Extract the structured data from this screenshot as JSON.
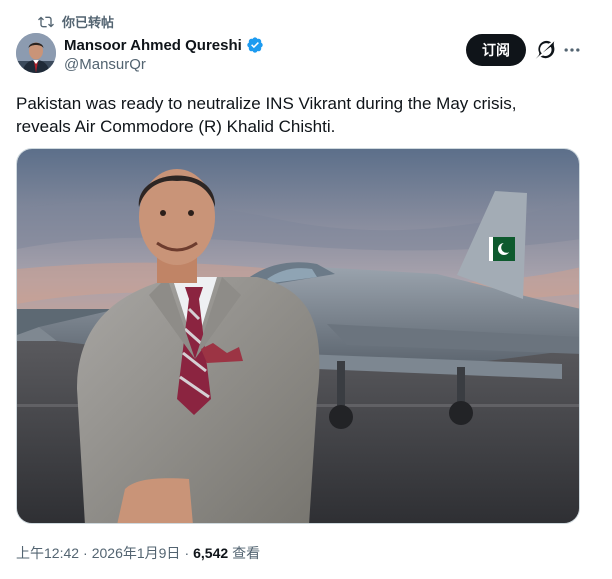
{
  "repost": {
    "label": "你已转帖",
    "icon": "repost-icon"
  },
  "author": {
    "name": "Mansoor Ahmed Qureshi",
    "handle": "@MansurQr",
    "verified": true,
    "verified_color": "#1d9bf0"
  },
  "actions": {
    "subscribe_label": "订阅",
    "grok_icon": "grok-icon",
    "more_icon": "more-icon"
  },
  "tweet": {
    "text_line1": "Pakistan was ready to neutralize INS Vikrant during the May crisis,",
    "text_line2": "reveals Air Commodore (R) Khalid Chishti."
  },
  "meta": {
    "time": "上午12:42",
    "date": "2026年1月9日",
    "views": "6,542",
    "views_label": "查看"
  }
}
